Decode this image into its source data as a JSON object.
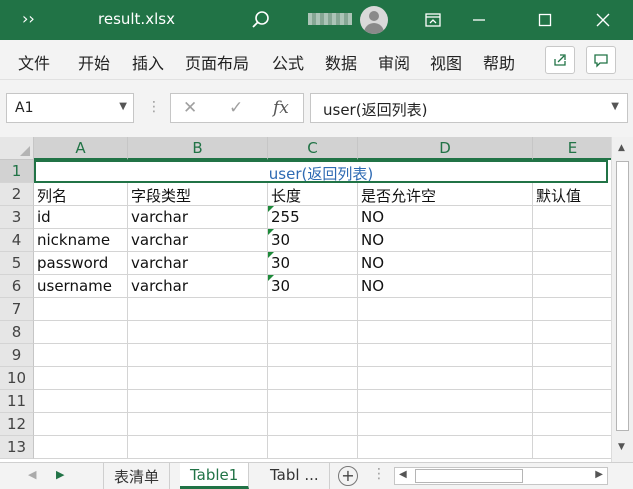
{
  "titlebar": {
    "qat": "››",
    "filename": "result.xlsx"
  },
  "ribbon": {
    "tabs": [
      "文件",
      "开始",
      "插入",
      "页面布局",
      "公式",
      "数据",
      "审阅",
      "视图",
      "帮助"
    ]
  },
  "formula_bar": {
    "name_box": "A1",
    "formula": "user(返回列表)"
  },
  "columns": [
    "A",
    "B",
    "C",
    "D",
    "E"
  ],
  "rows": [
    "1",
    "2",
    "3",
    "4",
    "5",
    "6",
    "7",
    "8",
    "9",
    "10",
    "11",
    "12",
    "13"
  ],
  "sheet": {
    "merged_title": "user(返回列表)",
    "headers": [
      "列名",
      "字段类型",
      "长度",
      "是否允许空",
      "默认值"
    ],
    "data": [
      [
        "id",
        "varchar",
        "255",
        "NO",
        ""
      ],
      [
        "nickname",
        "varchar",
        "30",
        "NO",
        ""
      ],
      [
        "password",
        "varchar",
        "30",
        "NO",
        ""
      ],
      [
        "username",
        "varchar",
        "30",
        "NO",
        ""
      ]
    ]
  },
  "sheet_tabs": [
    "表清单",
    "Table1",
    "Tabl ..."
  ],
  "active_sheet": "Table1",
  "colors": {
    "accent": "#217346",
    "title_text": "#2e6ab3"
  }
}
